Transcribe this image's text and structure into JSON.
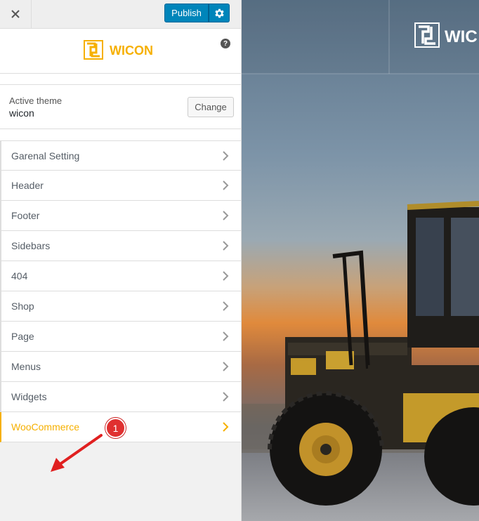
{
  "topbar": {
    "publish_label": "Publish"
  },
  "brand": {
    "name": "WICON",
    "accent": "#F6B000"
  },
  "theme": {
    "label": "Active theme",
    "name": "wicon",
    "change_label": "Change"
  },
  "menu": [
    {
      "label": "Garenal Setting"
    },
    {
      "label": "Header"
    },
    {
      "label": "Footer"
    },
    {
      "label": "Sidebars"
    },
    {
      "label": "404"
    },
    {
      "label": "Shop"
    },
    {
      "label": "Page"
    },
    {
      "label": "Menus"
    },
    {
      "label": "Widgets"
    },
    {
      "label": "WooCommerce"
    }
  ],
  "annotation": {
    "step": "1"
  },
  "preview": {
    "brand": "WIC"
  }
}
